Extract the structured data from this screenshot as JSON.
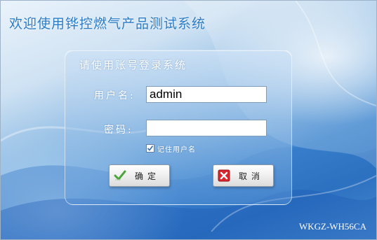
{
  "app": {
    "title": "欢迎使用铧控燃气产品测试系统",
    "model_code": "WKGZ-WH56CA"
  },
  "login": {
    "heading": "请使用账号登录系统",
    "username_label": "用户名:",
    "username_value": "admin",
    "password_label": "密码:",
    "password_value": "",
    "remember_label": "记住用户名",
    "remember_checked": true,
    "ok_label": "确定",
    "cancel_label": "取消"
  },
  "icons": {
    "ok": "checkmark-icon",
    "cancel": "close-icon",
    "remember": "checkbox-checked-icon"
  },
  "colors": {
    "title": "#2d7cc6",
    "ok_icon": "#4aa63a",
    "cancel_icon": "#d8262d"
  }
}
